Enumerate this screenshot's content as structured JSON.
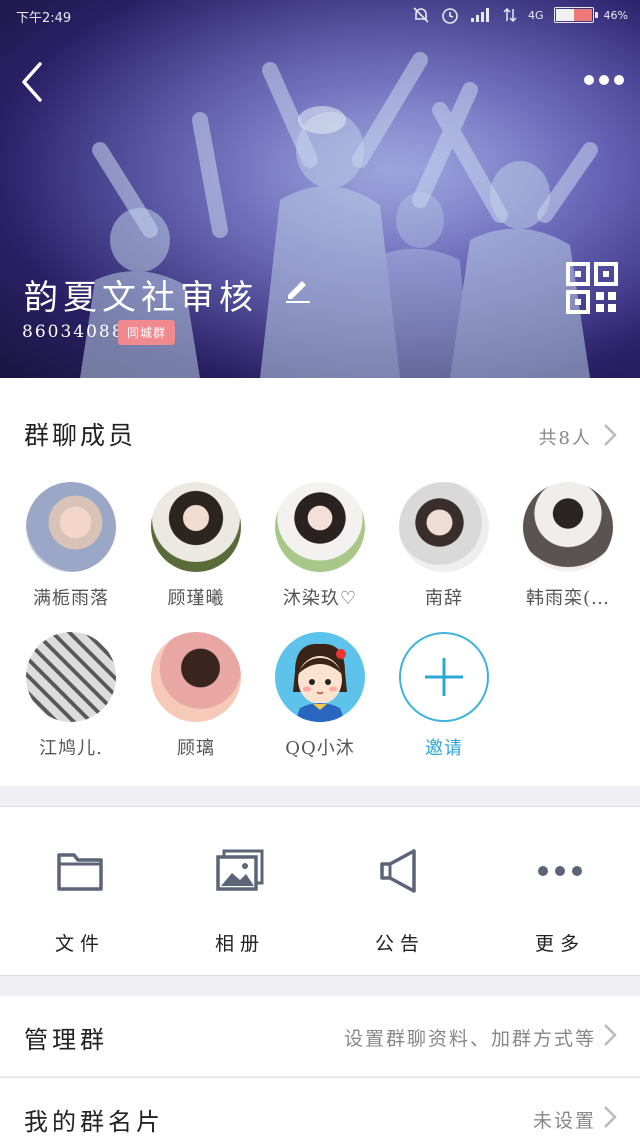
{
  "status": {
    "time": "下午2:49",
    "network": "4G",
    "battery": "46%"
  },
  "group": {
    "name": "韵夏文社审核",
    "id": "860340883",
    "tag": "同城群"
  },
  "members": {
    "title": "群聊成员",
    "count": "共8人",
    "list": [
      {
        "name": "满栀雨落"
      },
      {
        "name": "顾瑾曦"
      },
      {
        "name": "沐染玖♡"
      },
      {
        "name": "南辞"
      },
      {
        "name": "韩雨栾(…"
      },
      {
        "name": "江鸠儿."
      },
      {
        "name": "顾璃"
      },
      {
        "name": "QQ小沐"
      }
    ],
    "invite": "邀请"
  },
  "actions": [
    {
      "label": "文件",
      "icon": "folder-icon"
    },
    {
      "label": "相册",
      "icon": "album-icon"
    },
    {
      "label": "公告",
      "icon": "megaphone-icon"
    },
    {
      "label": "更多",
      "icon": "more-dots-icon"
    }
  ],
  "rows": [
    {
      "label": "管理群",
      "value": "设置群聊资料、加群方式等"
    },
    {
      "label": "我的群名片",
      "value": "未设置"
    }
  ],
  "colors": {
    "accent": "#2ea6d6",
    "tag": "#f08a8e",
    "header": "#3b2f8a"
  }
}
